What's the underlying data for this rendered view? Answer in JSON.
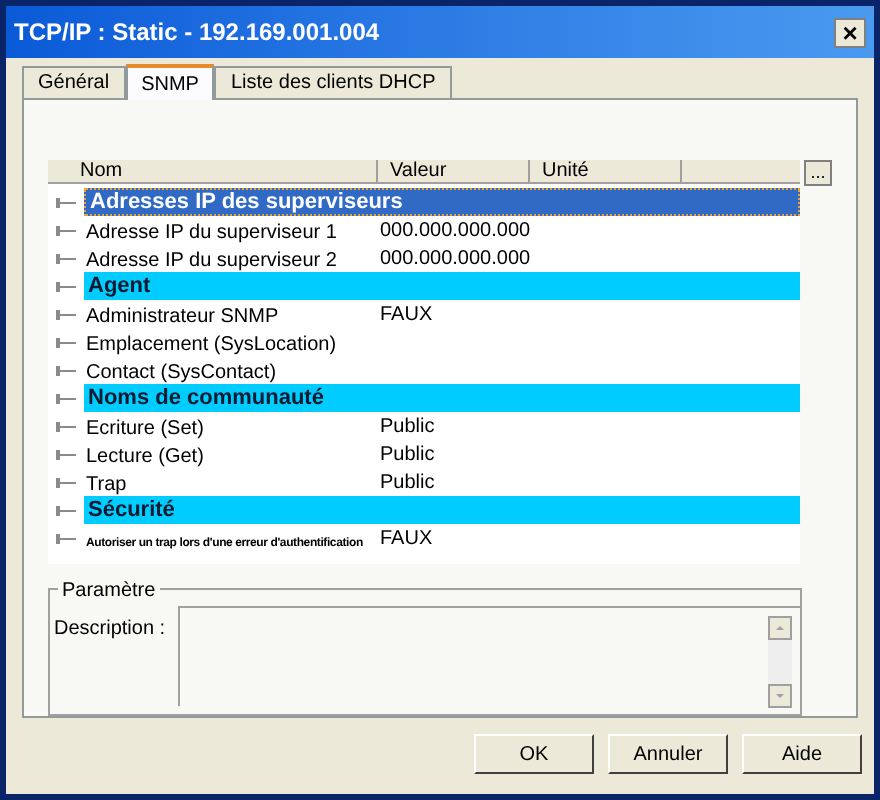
{
  "window": {
    "title": "TCP/IP : Static - 192.169.001.004",
    "close": "×"
  },
  "tabs": [
    {
      "label": "Général",
      "selected": false
    },
    {
      "label": "SNMP",
      "selected": true
    },
    {
      "label": "Liste des clients DHCP",
      "selected": false
    }
  ],
  "table": {
    "columns": [
      "Nom",
      "Valeur",
      "Unité"
    ],
    "more_button": "...",
    "rows": [
      {
        "kind": "group",
        "name": "Adresses IP des superviseurs",
        "selected": true
      },
      {
        "kind": "item",
        "name": "Adresse IP du superviseur 1",
        "value": "000.000.000.000"
      },
      {
        "kind": "item",
        "name": "Adresse IP du superviseur 2",
        "value": "000.000.000.000"
      },
      {
        "kind": "group",
        "name": "Agent",
        "selected": false
      },
      {
        "kind": "item",
        "name": "Administrateur SNMP",
        "value": "FAUX"
      },
      {
        "kind": "item",
        "name": "Emplacement (SysLocation)"
      },
      {
        "kind": "item",
        "name": "Contact (SysContact)"
      },
      {
        "kind": "group",
        "name": "Noms de communauté",
        "selected": false
      },
      {
        "kind": "item",
        "name": "Ecriture (Set)",
        "value": "Public"
      },
      {
        "kind": "item",
        "name": "Lecture (Get)",
        "value": "Public"
      },
      {
        "kind": "item",
        "name": "Trap",
        "value": "Public"
      },
      {
        "kind": "group",
        "name": "Sécurité",
        "selected": false
      },
      {
        "kind": "small",
        "name": "Autoriser un trap lors d'une erreur d'authentification",
        "value": "FAUX"
      }
    ]
  },
  "parameter": {
    "title": "Paramètre",
    "description_label": "Description :"
  },
  "buttons": [
    "OK",
    "Annuler",
    "Aide"
  ]
}
